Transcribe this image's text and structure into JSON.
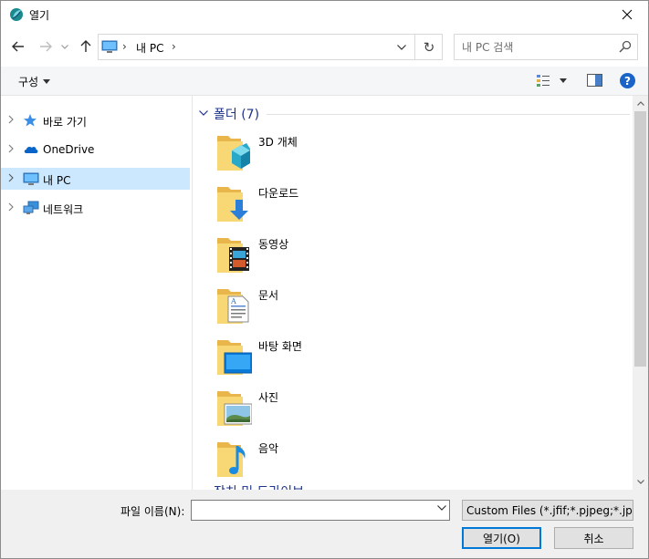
{
  "window": {
    "title": "열기",
    "close_glyph": "✕"
  },
  "address": {
    "segments": [
      "내 PC"
    ],
    "separator": "›",
    "refresh_glyph": "↻"
  },
  "search": {
    "placeholder": "내 PC 검색"
  },
  "toolbar": {
    "organize_label": "구성",
    "help_glyph": "?"
  },
  "nav_pane": {
    "items": [
      {
        "label": "바로 가기",
        "icon": "star-icon",
        "selected": false
      },
      {
        "label": "OneDrive",
        "icon": "cloud-icon",
        "selected": false
      },
      {
        "label": "내 PC",
        "icon": "computer-icon",
        "selected": true
      },
      {
        "label": "네트워크",
        "icon": "network-icon",
        "selected": false
      }
    ]
  },
  "content": {
    "group_title": "폴더 (7)",
    "folders": [
      {
        "label": "3D 개체",
        "icon": "3d-objects-icon"
      },
      {
        "label": "다운로드",
        "icon": "downloads-icon"
      },
      {
        "label": "동영상",
        "icon": "videos-icon"
      },
      {
        "label": "문서",
        "icon": "documents-icon"
      },
      {
        "label": "바탕 화면",
        "icon": "desktop-icon"
      },
      {
        "label": "사진",
        "icon": "pictures-icon"
      },
      {
        "label": "음악",
        "icon": "music-icon"
      }
    ],
    "next_group_partial": "장치 및 드라이브"
  },
  "bottom": {
    "filename_label": "파일 이름(N):",
    "filename_value": "",
    "filetype_value": "Custom Files (*.jfif;*.pjpeg;*.jpeg;*.pjp;*.jpg;*.png)",
    "open_label": "열기(O)",
    "cancel_label": "취소"
  },
  "colors": {
    "accent": "#0078d7",
    "selection": "#cce8ff",
    "group_header": "#1e3287",
    "folder_yellow": "#f8d775"
  }
}
